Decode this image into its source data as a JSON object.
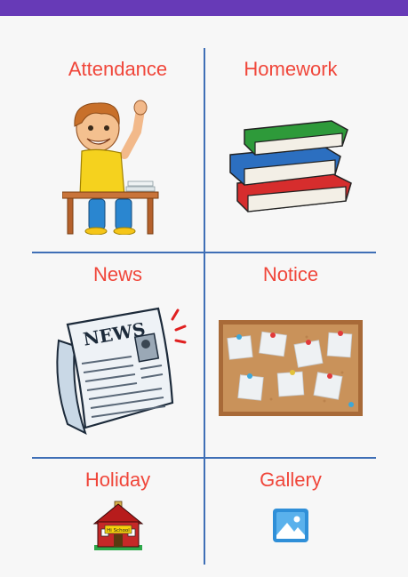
{
  "menu": {
    "items": [
      {
        "label": "Attendance",
        "icon": "student-raising-hand-icon"
      },
      {
        "label": "Homework",
        "icon": "stack-of-books-icon"
      },
      {
        "label": "News",
        "icon": "newspaper-icon"
      },
      {
        "label": "Notice",
        "icon": "notice-board-icon"
      },
      {
        "label": "Holiday",
        "icon": "school-house-icon"
      },
      {
        "label": "Gallery",
        "icon": "gallery-image-icon"
      }
    ]
  },
  "illustration_text": {
    "newspaper_masthead": "NEWS",
    "school_sign": "Hi School"
  },
  "colors": {
    "status_bar": "#673ab7",
    "divider": "#3f6fb6",
    "label": "#f0463a",
    "background": "#f7f7f7"
  }
}
